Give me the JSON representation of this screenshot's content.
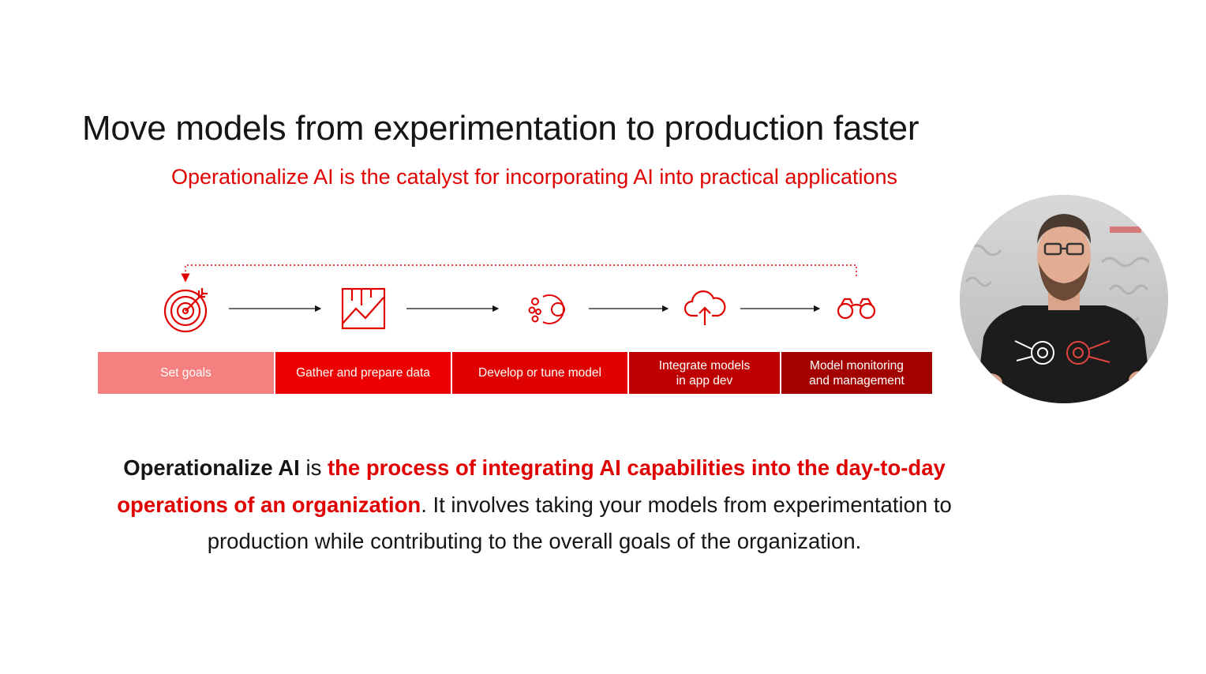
{
  "slide": {
    "title": "Move models from experimentation to production faster",
    "subtitle": "Operationalize AI is the catalyst for incorporating AI into practical applications"
  },
  "workflow": {
    "stages": [
      {
        "label": "Set goals",
        "icon": "target-icon",
        "color": "#f48080"
      },
      {
        "label": "Gather and prepare data",
        "icon": "data-chart-icon",
        "color": "#ee0000"
      },
      {
        "label": "Develop or tune model",
        "icon": "model-gears-icon",
        "color": "#e00000"
      },
      {
        "label": "Integrate models\nin app dev",
        "icon": "cloud-upload-icon",
        "color": "#be0000"
      },
      {
        "label": "Model monitoring\nand management",
        "icon": "binoculars-icon",
        "color": "#a30000"
      }
    ],
    "loop_color": "#e00000"
  },
  "description": {
    "lead": "Operationalize AI",
    "connector": " is ",
    "highlight": "the process of integrating AI capabilities into the day-to-day operations of an organization",
    "rest": ". It involves taking your models from experimentation to production while contributing to the overall goals of the organization."
  },
  "presenter": {
    "icon": "presenter-video-icon"
  },
  "colors": {
    "brand_red": "#ee0000",
    "text": "#151515"
  }
}
